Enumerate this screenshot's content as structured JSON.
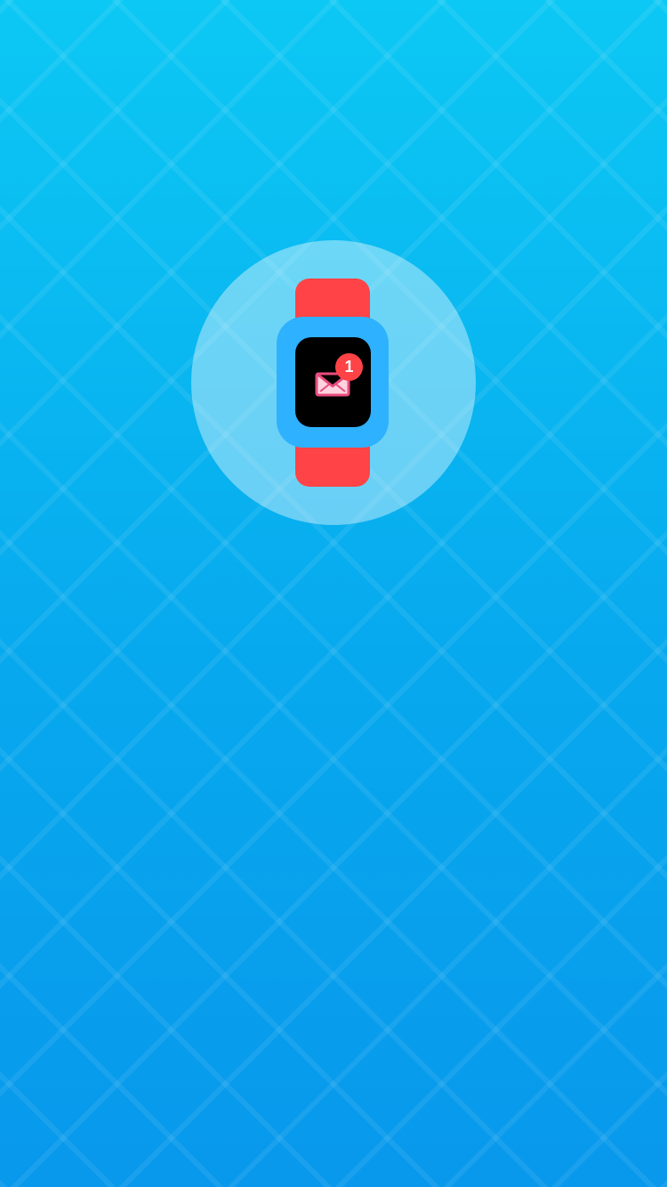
{
  "notification": {
    "badge_count": "1"
  },
  "colors": {
    "background_top": "#0cc8f4",
    "background_bottom": "#0898ec",
    "watch_band": "#ff4346",
    "watch_case": "#2eb1ff",
    "watch_screen": "#000000",
    "envelope": "#ff7ca7",
    "badge": "#ff4346"
  }
}
